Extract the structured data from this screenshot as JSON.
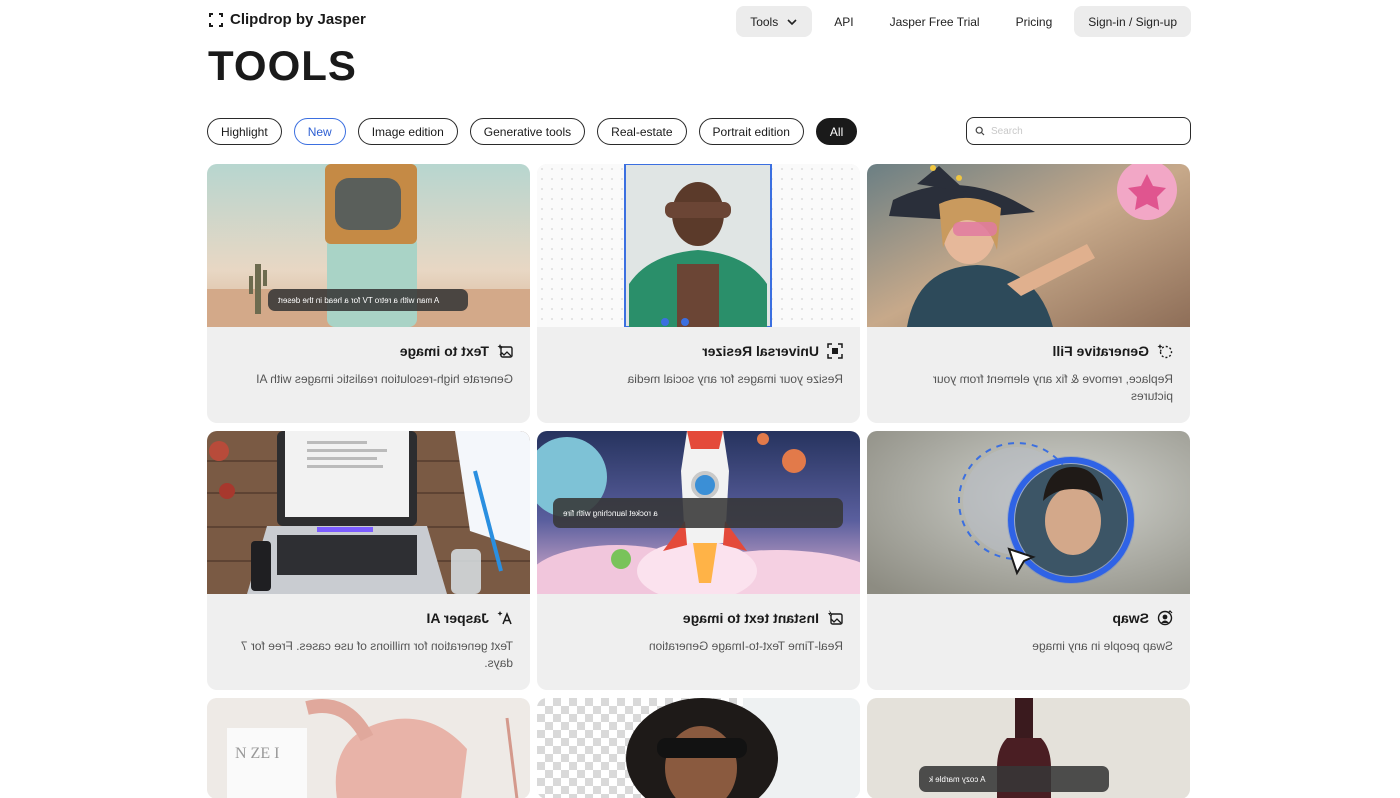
{
  "header": {
    "logo_text": "Clipdrop by Jasper",
    "nav": [
      {
        "label": "Tools",
        "has_chevron": true,
        "style": "grey"
      },
      {
        "label": "API"
      },
      {
        "label": "Jasper Free Trial"
      },
      {
        "label": "Pricing"
      },
      {
        "label": "Sign-in / Sign-up",
        "style": "grey"
      }
    ]
  },
  "page_title": "TOOLS",
  "filters": [
    "Highlight",
    "New",
    "Image edition",
    "Generative tools",
    "Real-estate",
    "Portrait edition",
    "All"
  ],
  "active_filter": "All",
  "search": {
    "placeholder": "Search",
    "value": ""
  },
  "tools": [
    {
      "name": "Text to image",
      "icon": "image-sparkle-icon",
      "description": "Generate high-resolution realistic images with AI",
      "overlay": "A man with a retro TV for a head in the desert"
    },
    {
      "name": "Universal Resizer",
      "icon": "resize-frame-icon",
      "description": "Resize your images for any social media"
    },
    {
      "name": "Generative Fill",
      "icon": "dashed-circle-sparkle-icon",
      "description": "Replace, remove & fix any element from your pictures"
    },
    {
      "name": "Jasper AI",
      "icon": "text-sparkle-icon",
      "description": "Text generation for millions of use cases. Free for 7 days."
    },
    {
      "name": "Instant text to image",
      "icon": "image-bolt-icon",
      "description": "Real-Time Text-to-Image Generation",
      "overlay": "a rocket launching with fire"
    },
    {
      "name": "Swap",
      "icon": "face-swap-icon",
      "description": "Swap people in any image"
    },
    {
      "name": "",
      "icon": "",
      "description": ""
    },
    {
      "name": "",
      "icon": "",
      "description": ""
    },
    {
      "name": "",
      "icon": "",
      "description": "",
      "overlay": "A cozy marble k"
    }
  ],
  "colors": {
    "accent_blue": "#3b6fe0",
    "card_bg": "#efefef",
    "chip_active": "#1a1a1a"
  }
}
